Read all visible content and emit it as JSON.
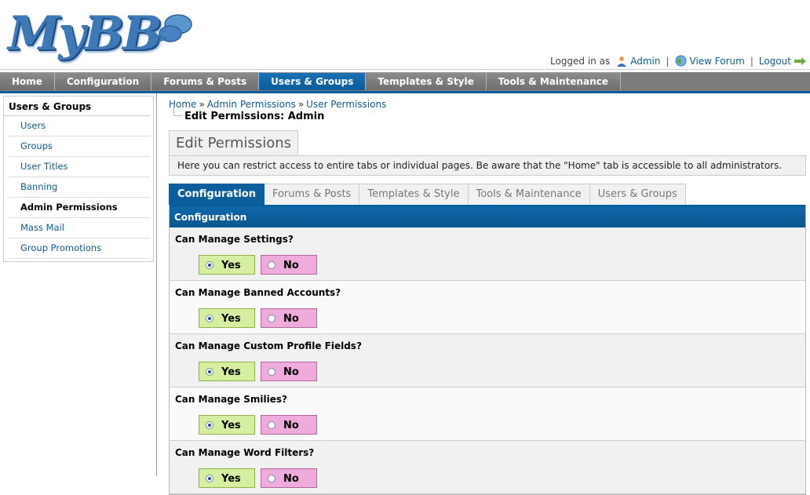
{
  "header": {
    "logo_text": "MyBB",
    "logged_in_as": "Logged in as",
    "user_name": "Admin",
    "view_forum": "View Forum",
    "logout": "Logout",
    "separator": "|"
  },
  "menu": {
    "tabs": [
      {
        "label": "Home"
      },
      {
        "label": "Configuration"
      },
      {
        "label": "Forums & Posts"
      },
      {
        "label": "Users & Groups"
      },
      {
        "label": "Templates & Style"
      },
      {
        "label": "Tools & Maintenance"
      }
    ],
    "active_index": 3
  },
  "sidebar": {
    "title": "Users & Groups",
    "items": [
      {
        "label": "Users"
      },
      {
        "label": "Groups"
      },
      {
        "label": "User Titles"
      },
      {
        "label": "Banning"
      },
      {
        "label": "Admin Permissions"
      },
      {
        "label": "Mass Mail"
      },
      {
        "label": "Group Promotions"
      }
    ],
    "active_index": 4
  },
  "breadcrumb": {
    "items": [
      "Home",
      "Admin Permissions",
      "User Permissions"
    ],
    "separator": "»",
    "current": "Edit Permissions: Admin"
  },
  "page": {
    "title": "Edit Permissions",
    "description": "Here you can restrict access to entire tabs or individual pages. Be aware that the \"Home\" tab is accessible to all administrators."
  },
  "perm_tabs": {
    "items": [
      "Configuration",
      "Forums & Posts",
      "Templates & Style",
      "Tools & Maintenance",
      "Users & Groups"
    ],
    "active_index": 0
  },
  "table": {
    "header": "Configuration",
    "yes_label": "Yes",
    "no_label": "No",
    "rows": [
      {
        "question": "Can Manage Settings?",
        "value": "Yes"
      },
      {
        "question": "Can Manage Banned Accounts?",
        "value": "Yes"
      },
      {
        "question": "Can Manage Custom Profile Fields?",
        "value": "Yes"
      },
      {
        "question": "Can Manage Smilies?",
        "value": "Yes"
      },
      {
        "question": "Can Manage Word Filters?",
        "value": "Yes"
      }
    ]
  },
  "colors": {
    "accent": "#0b5d9c",
    "menu_bg": "#7c7c7c",
    "yes_bg": "#d6eea0",
    "no_bg": "#eeabdc",
    "link": "#0f5c8e"
  }
}
